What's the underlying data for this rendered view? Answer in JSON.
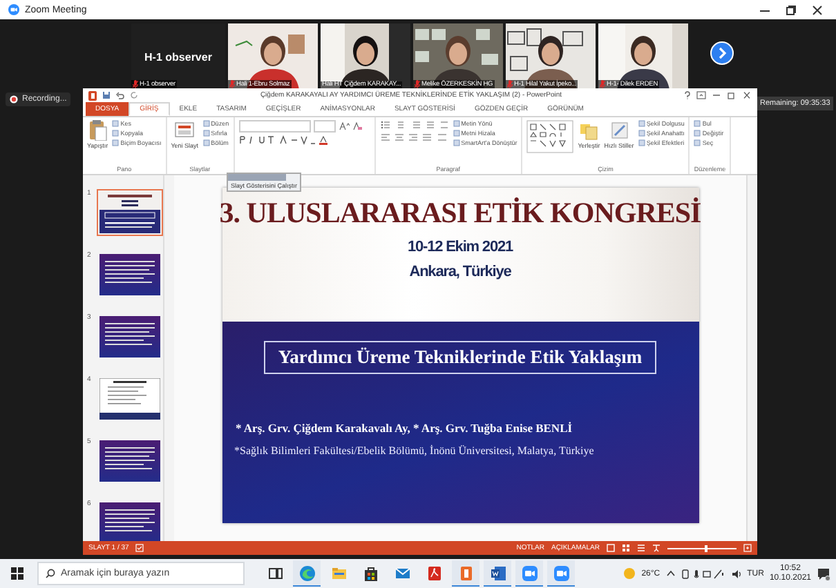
{
  "window": {
    "title": "Zoom Meeting"
  },
  "participants": [
    {
      "kind": "no-video",
      "tile_name": "H-1 observer",
      "label": "H-1 observer",
      "muted": true
    },
    {
      "kind": "video",
      "label": "Hali 1-Ebru Solmaz",
      "muted": true
    },
    {
      "kind": "video",
      "label": "Hali HT Çiğdem KARAKAY...",
      "muted": false
    },
    {
      "kind": "video",
      "label": "Melike ÖZERKESKİN HG",
      "muted": true
    },
    {
      "kind": "video",
      "label": "H-1 Hilal Yakut İpeko...",
      "muted": true
    },
    {
      "kind": "video",
      "label": "H-1- Dilek ERDEN",
      "muted": true
    }
  ],
  "recording": "Recording...",
  "remaining": "Remaining: 09:35:33",
  "powerpoint": {
    "title": "Çiğdem KARAKAYALI AY YARDIMCI ÜREME TEKNİKLERİNDE ETİK YAKLAŞIM (2) - PowerPoint",
    "tabs": [
      {
        "label": "DOSYA",
        "kind": "file",
        "selected": false
      },
      {
        "label": "GİRİŞ",
        "kind": "tab",
        "selected": true
      },
      {
        "label": "EKLE",
        "kind": "tab",
        "selected": false
      },
      {
        "label": "TASARIM",
        "kind": "tab",
        "selected": false
      },
      {
        "label": "GEÇİŞLER",
        "kind": "tab",
        "selected": false
      },
      {
        "label": "ANİMASYONLAR",
        "kind": "tab",
        "selected": false
      },
      {
        "label": "SLAYT GÖSTERİSİ",
        "kind": "tab",
        "selected": false
      },
      {
        "label": "GÖZDEN GEÇİR",
        "kind": "tab",
        "selected": false
      },
      {
        "label": "GÖRÜNÜM",
        "kind": "tab",
        "selected": false
      }
    ],
    "ribbon": [
      {
        "kind": "clipboard",
        "label": "Pano",
        "big": [
          "Yapıştır"
        ],
        "small": [
          "Kes",
          "Kopyala",
          "Biçim Boyacısı"
        ]
      },
      {
        "kind": "slides",
        "label": "Slaytlar",
        "big": [
          "Yeni Slayt"
        ],
        "small": [
          "Düzen",
          "Sıfırla",
          "Bölüm"
        ]
      },
      {
        "kind": "font"
      },
      {
        "kind": "paragraph",
        "label": "Paragraf",
        "small": [
          "Metin Yönü",
          "Metni Hizala",
          "SmartArt'a Dönüştür"
        ]
      },
      {
        "kind": "drawing",
        "label": "Çizim",
        "big": [
          "Yerleştir",
          "Hızlı Stiller"
        ],
        "small": [
          "Şekil Dolgusu",
          "Şekil Anahattı",
          "Şekil Efektleri"
        ]
      },
      {
        "kind": "editing",
        "label": "Düzenleme",
        "small": [
          "Bul",
          "Değiştir",
          "Seç"
        ]
      }
    ],
    "tooltip": "Slayt Gösterisini Çalıştır",
    "thumbnails": [
      {
        "number": "1",
        "kind": "title",
        "selected": true
      },
      {
        "number": "2",
        "kind": "text",
        "selected": false
      },
      {
        "number": "3",
        "kind": "text",
        "selected": false
      },
      {
        "number": "4",
        "kind": "list",
        "selected": false
      },
      {
        "number": "5",
        "kind": "text",
        "selected": false
      },
      {
        "number": "6",
        "kind": "text",
        "selected": false
      }
    ],
    "slide": {
      "title": "3. ULUSLARARASI ETİK KONGRESİ",
      "date": "10-12 Ekim 2021",
      "place": "Ankara, Türkiye",
      "topic": "Yardımcı Üreme Tekniklerinde Etik Yaklaşım",
      "authors": "* Arş. Grv. Çiğdem Karakavalı Ay,  * Arş. Grv. Tuğba Enise BENLİ",
      "affiliation": "*Sağlık Bilimleri Fakültesi/Ebelik Bölümü, İnönü Üniversitesi, Malatya, Türkiye"
    },
    "status_bar": {
      "slide": "SLAYT 1 / 37",
      "notes": "NOTLAR",
      "comments": "AÇIKLAMALAR",
      "zoom_slider": {
        "level": 0.55
      }
    }
  },
  "taskbar": {
    "search": {
      "placeholder": "Aramak için buraya yazın"
    },
    "apps": [
      {
        "kind": "taskview",
        "running": false
      },
      {
        "kind": "edge",
        "running": true
      },
      {
        "kind": "folder",
        "running": false
      },
      {
        "kind": "store",
        "running": false
      },
      {
        "kind": "mail",
        "running": false
      },
      {
        "kind": "acrobat",
        "running": false
      },
      {
        "kind": "office",
        "running": true
      },
      {
        "kind": "word",
        "running": true
      },
      {
        "kind": "zoom",
        "running": true
      },
      {
        "kind": "zoom",
        "running": true
      }
    ],
    "weather": "26°C",
    "language": "TUR",
    "time": "10:52",
    "date": "10.10.2021"
  }
}
